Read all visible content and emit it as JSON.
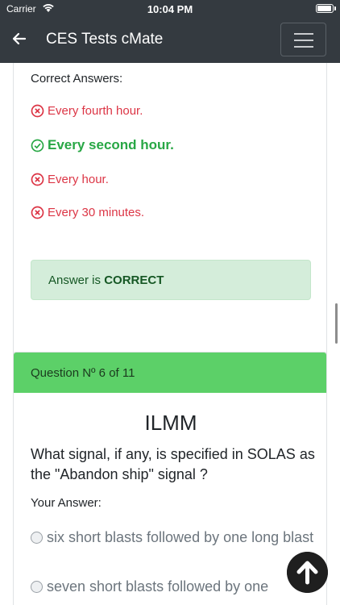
{
  "status_bar": {
    "carrier": "Carrier",
    "time": "10:04 PM"
  },
  "navbar": {
    "title": "CES Tests cMate"
  },
  "previous_question": {
    "section_label": "Correct Answers:",
    "answers": [
      {
        "text": "Every fourth hour.",
        "state": "wrong"
      },
      {
        "text": "Every second hour.",
        "state": "correct"
      },
      {
        "text": "Every hour.",
        "state": "wrong"
      },
      {
        "text": "Every 30 minutes.",
        "state": "wrong"
      }
    ],
    "result_prefix": "Answer is ",
    "result_value": "CORRECT"
  },
  "current_question": {
    "header": "Question Nº 6 of 11",
    "category": "ILMM",
    "question": "What signal, if any, is specified in SOLAS as the \"Abandon ship\" signal ?",
    "your_answer_label": "Your Answer:",
    "options": [
      "six short blasts followed by one long blast",
      "seven short blasts followed by one"
    ]
  },
  "colors": {
    "navbar": "#343a40",
    "correct": "#28a745",
    "wrong": "#dc3545",
    "header_green": "#5cd068"
  },
  "icons": {
    "back": "arrow-left-icon",
    "menu": "hamburger-menu-icon",
    "scroll_top": "arrow-up-circle-icon"
  }
}
